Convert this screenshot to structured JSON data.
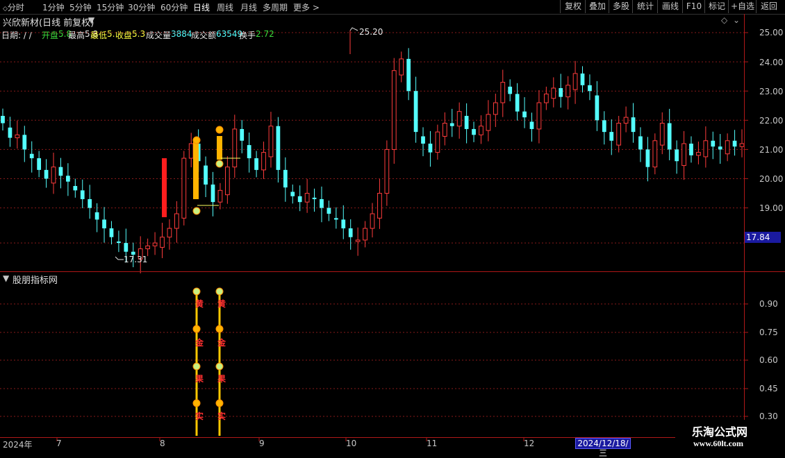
{
  "toolbar": {
    "timeframes": [
      "分时",
      "1分钟",
      "5分钟",
      "15分钟",
      "30分钟",
      "60分钟",
      "日线",
      "周线",
      "月线",
      "多周期",
      "更多 >"
    ],
    "active_timeframe": "日线",
    "right_buttons": [
      "复权",
      "叠加",
      "多股",
      "统计",
      "画线",
      "F10",
      "标记",
      "+自选",
      "返回"
    ]
  },
  "stock": {
    "title": "兴欣新材(日线 前复权)"
  },
  "info_bar": {
    "date_label": "日期: / /",
    "fields": [
      {
        "label": "开盘",
        "value": "5.8",
        "color": "#3cdc3c"
      },
      {
        "label": "最高",
        "value": "5.8",
        "color": "#e8e8e8"
      },
      {
        "label": "最低",
        "value": "5.",
        "color": "#ffff40"
      },
      {
        "label": "收盘",
        "value": "5.3",
        "color": "#ffff40"
      },
      {
        "label": "成交量",
        "value": "3884",
        "color": "#e8e8e8"
      },
      {
        "label": "成交额",
        "value": "63549",
        "color": "#e8e8e8"
      },
      {
        "label": "换手",
        "value": "2.72",
        "color": "#ffff40"
      }
    ]
  },
  "main_chart": {
    "high_label": "25.20",
    "low_label": "17.31",
    "current_price": "17.84",
    "y_ticks": [
      "25.00",
      "24.00",
      "23.00",
      "22.00",
      "21.00",
      "20.00",
      "19.00"
    ]
  },
  "indicator": {
    "title": "股朋指标网",
    "y_ticks": [
      "0.90",
      "0.75",
      "0.60",
      "0.45",
      "0.30"
    ],
    "chars": [
      "黄",
      "金",
      "果",
      "实"
    ]
  },
  "x_axis": {
    "labels": [
      "2024年",
      "7",
      "8",
      "9",
      "10",
      "11",
      "12"
    ],
    "cursor_date": "2024/12/18/三"
  },
  "watermark": {
    "title": "乐淘公式网",
    "url": "www.60lt.com"
  },
  "colors": {
    "up": "#ff3c3c",
    "down": "#54ffff",
    "grid": "#8a1a1a",
    "accent": "#ffd700"
  },
  "chart_data": {
    "type": "candlestick",
    "x_labels": [
      "2024年",
      "7",
      "8",
      "9",
      "10",
      "11",
      "12"
    ],
    "y_range": [
      17.0,
      25.5
    ],
    "series": [
      {
        "values": [
          21.9,
          21.4,
          21.5,
          21.0,
          20.7,
          20.3,
          20.0,
          20.4,
          20.1,
          19.9,
          19.6,
          19.3,
          19.0,
          18.6,
          18.3,
          18.0,
          17.8,
          17.5,
          17.4,
          17.6,
          17.7,
          17.8,
          18.0,
          18.3,
          18.8,
          20.7,
          21.2,
          20.6,
          19.8,
          19.2,
          19.6,
          20.4,
          21.7,
          21.3,
          20.7,
          20.3,
          20.9,
          21.8,
          20.3,
          19.7,
          19.4,
          19.2,
          19.5,
          19.3,
          19.0,
          18.8,
          18.6,
          18.3,
          18.0,
          17.9,
          18.3,
          18.8,
          19.5,
          21.0,
          23.7,
          24.1,
          23.0,
          21.6,
          21.2,
          20.9,
          21.6,
          21.9,
          21.8,
          22.3,
          21.7,
          21.5,
          21.8,
          22.2,
          22.6,
          23.3,
          22.9,
          22.3,
          22.1,
          21.7,
          22.6,
          22.9,
          23.1,
          22.8,
          23.2,
          23.6,
          23.2,
          23.0,
          22.0,
          21.6,
          21.3,
          21.9,
          22.1,
          21.6,
          21.0,
          20.4,
          21.3,
          21.9,
          21.0,
          20.6,
          21.2,
          20.8,
          20.9,
          21.3,
          21.1,
          21.0,
          21.3,
          21.1,
          21.2
        ]
      }
    ]
  }
}
